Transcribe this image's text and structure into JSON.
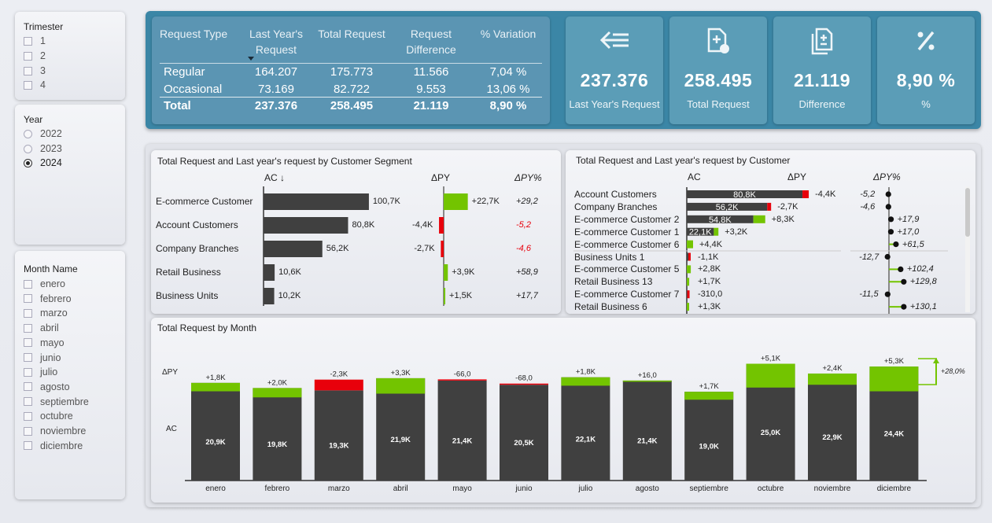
{
  "slicers": {
    "trimester": {
      "title": "Trimester",
      "options": [
        "1",
        "2",
        "3",
        "4"
      ]
    },
    "year": {
      "title": "Year",
      "options": [
        "2022",
        "2023",
        "2024"
      ],
      "selected": "2024"
    },
    "month": {
      "title": "Month Name",
      "options": [
        "enero",
        "febrero",
        "marzo",
        "abril",
        "mayo",
        "junio",
        "julio",
        "agosto",
        "septiembre",
        "octubre",
        "noviembre",
        "diciembre"
      ]
    }
  },
  "summary_table": {
    "headers": [
      "Request Type",
      "Last Year's Request",
      "Total Request",
      "Request Difference",
      "% Variation"
    ],
    "rows": [
      {
        "type": "Regular",
        "ly": "164.207",
        "total": "175.773",
        "diff": "11.566",
        "var": "7,04 %"
      },
      {
        "type": "Occasional",
        "ly": "73.169",
        "total": "82.722",
        "diff": "9.553",
        "var": "13,06 %"
      }
    ],
    "total": {
      "type": "Total",
      "ly": "237.376",
      "total": "258.495",
      "diff": "21.119",
      "var": "8,90 %"
    }
  },
  "kpis": [
    {
      "value": "237.376",
      "label": "Last Year's Request",
      "icon": "arrow-left-lines-icon"
    },
    {
      "value": "258.495",
      "label": "Total Request",
      "icon": "document-add-icon"
    },
    {
      "value": "21.119",
      "label": "Difference",
      "icon": "documents-plusminus-icon"
    },
    {
      "value": "8,90 %",
      "label": "%",
      "icon": "percent-icon"
    }
  ],
  "colors": {
    "ac": "#404040",
    "positive": "#73c400",
    "negative": "#e8000b",
    "top_bg": "#3b86a6"
  },
  "segment_chart": {
    "title": "Total Request and Last year's request by Customer Segment",
    "col_ac": "AC ↓",
    "col_dpy": "ΔPY",
    "col_dpyp": "ΔPY%",
    "rows": [
      {
        "name": "E-commerce Customer",
        "ac": 100.7,
        "ac_label": "100,7K",
        "dpy": 22.7,
        "dpy_label": "+22,7K",
        "dpyp": 29.2,
        "dpyp_label": "+29,2"
      },
      {
        "name": "Account Customers",
        "ac": 80.8,
        "ac_label": "80,8K",
        "dpy": -4.4,
        "dpy_label": "-4,4K",
        "dpyp": -5.2,
        "dpyp_label": "-5,2"
      },
      {
        "name": "Company Branches",
        "ac": 56.2,
        "ac_label": "56,2K",
        "dpy": -2.7,
        "dpy_label": "-2,7K",
        "dpyp": -4.6,
        "dpyp_label": "-4,6"
      },
      {
        "name": "Retail Business",
        "ac": 10.6,
        "ac_label": "10,6K",
        "dpy": 3.9,
        "dpy_label": "+3,9K",
        "dpyp": 58.9,
        "dpyp_label": "+58,9"
      },
      {
        "name": "Business Units",
        "ac": 10.2,
        "ac_label": "10,2K",
        "dpy": 1.5,
        "dpy_label": "+1,5K",
        "dpyp": 17.7,
        "dpyp_label": "+17,7"
      }
    ]
  },
  "customer_chart": {
    "title": "Total Request and Last year's request by Customer",
    "col_ac": "AC",
    "col_dpy": "ΔPY",
    "col_dpyp": "ΔPY%",
    "rows": [
      {
        "name": "Account Customers",
        "ac": 80.8,
        "ac_label": "80,8K",
        "dpy": -4.4,
        "dpy_label": "-4,4K",
        "dpyp": -5.2,
        "dpyp_label": "-5,2"
      },
      {
        "name": "Company Branches",
        "ac": 56.2,
        "ac_label": "56,2K",
        "dpy": -2.7,
        "dpy_label": "-2,7K",
        "dpyp": -4.6,
        "dpyp_label": "-4,6"
      },
      {
        "name": "E-commerce Customer 2",
        "ac": 54.8,
        "ac_label": "54,8K",
        "dpy": 8.3,
        "dpy_label": "+8,3K",
        "dpyp": 17.9,
        "dpyp_label": "+17,9"
      },
      {
        "name": "E-commerce Customer 1",
        "ac": 22.1,
        "ac_label": "22,1K",
        "dpy": 3.2,
        "dpy_label": "+3,2K",
        "dpyp": 17.0,
        "dpyp_label": "+17,0"
      },
      {
        "name": "E-commerce Customer 6",
        "ac": 4.4,
        "ac_label": "",
        "dpy": 4.4,
        "dpy_label": "+4,4K",
        "dpyp": 61.5,
        "dpyp_label": "+61,5"
      },
      {
        "name": "Business Units 1",
        "ac": 1.1,
        "ac_label": "",
        "dpy": -1.1,
        "dpy_label": "-1,1K",
        "dpyp": -12.7,
        "dpyp_label": "-12,7"
      },
      {
        "name": "E-commerce Customer 5",
        "ac": 2.8,
        "ac_label": "",
        "dpy": 2.8,
        "dpy_label": "+2,8K",
        "dpyp": 102.4,
        "dpyp_label": "+102,4"
      },
      {
        "name": "Retail Business 13",
        "ac": 1.7,
        "ac_label": "",
        "dpy": 1.7,
        "dpy_label": "+1,7K",
        "dpyp": 129.8,
        "dpyp_label": "+129,8"
      },
      {
        "name": "E-commerce Customer 7",
        "ac": 0.3,
        "ac_label": "",
        "dpy": -0.31,
        "dpy_label": "-310,0",
        "dpyp": -11.5,
        "dpyp_label": "-11,5"
      },
      {
        "name": "Retail Business 6",
        "ac": 1.3,
        "ac_label": "",
        "dpy": 1.3,
        "dpy_label": "+1,3K",
        "dpyp": 130.1,
        "dpyp_label": "+130,1"
      }
    ]
  },
  "chart_data": {
    "type": "bar",
    "title": "Total Request by Month",
    "row_labels": {
      "dpy": "ΔPY",
      "ac": "AC"
    },
    "categories": [
      "enero",
      "febrero",
      "marzo",
      "abril",
      "mayo",
      "junio",
      "julio",
      "agosto",
      "septiembre",
      "octubre",
      "noviembre",
      "diciembre"
    ],
    "series": [
      {
        "name": "AC",
        "values": [
          20.9,
          19.8,
          19.3,
          21.9,
          21.4,
          20.5,
          22.1,
          21.4,
          19.0,
          25.0,
          22.9,
          24.4
        ],
        "labels": [
          "20,9K",
          "19,8K",
          "19,3K",
          "21,9K",
          "21,4K",
          "20,5K",
          "22,1K",
          "21,4K",
          "19,0K",
          "25,0K",
          "22,9K",
          "24,4K"
        ]
      },
      {
        "name": "ΔPY",
        "values": [
          1.8,
          2.0,
          -2.3,
          3.3,
          -0.066,
          -0.068,
          1.8,
          0.016,
          1.7,
          5.1,
          2.4,
          5.3
        ],
        "labels": [
          "+1,8K",
          "+2,0K",
          "-2,3K",
          "+3,3K",
          "-66,0",
          "-68,0",
          "+1,8K",
          "+16,0",
          "+1,7K",
          "+5,1K",
          "+2,4K",
          "+5,3K"
        ]
      }
    ],
    "annotation": "+28,0%"
  }
}
